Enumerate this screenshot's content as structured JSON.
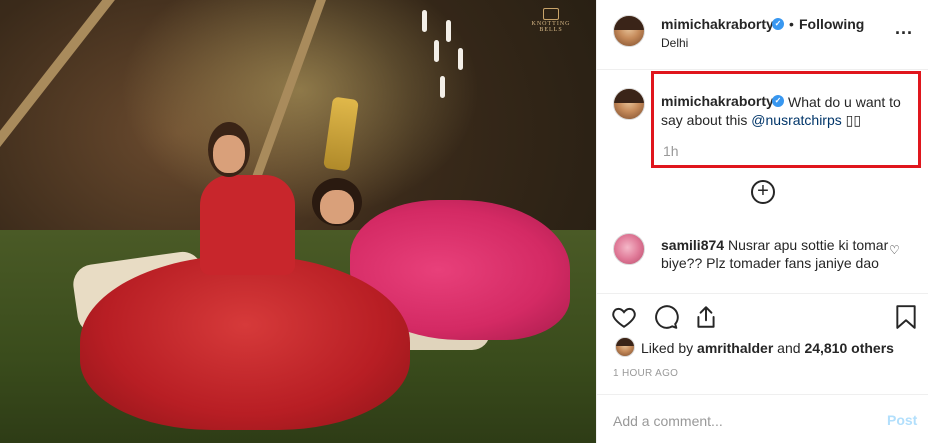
{
  "photo": {
    "alt_watermark": "KNOTTING BELLS",
    "icon": "wedding-photo"
  },
  "header": {
    "username": "mimichakraborty",
    "verified_icon": "verified-badge-icon",
    "separator": "•",
    "follow_status": "Following",
    "location": "Delhi",
    "more_icon": "more-options-icon",
    "more_label": "..."
  },
  "caption": {
    "username": "mimichakraborty",
    "text_before": "What do u want to say about this ",
    "mention": "@nusratchirps",
    "text_after": " ▯▯",
    "time": "1h",
    "highlight_color": "#e0161d"
  },
  "load_more": {
    "icon": "plus-circle-icon",
    "label": "+"
  },
  "comments": [
    {
      "username": "samili874",
      "text": "Nusrar apu sottie ki tomar biye?? Plz tomader fans janiye dao",
      "like_icon": "heart-outline-icon",
      "like_label": "♡"
    }
  ],
  "actions": {
    "like_icon": "heart-icon",
    "comment_icon": "comment-icon",
    "share_icon": "share-icon",
    "save_icon": "bookmark-icon"
  },
  "likes": {
    "prefix": "Liked by ",
    "user": "amrithalder",
    "middle": " and ",
    "count": "24,810 others"
  },
  "timestamp": "1 HOUR AGO",
  "add_comment": {
    "placeholder": "Add a comment...",
    "post_label": "Post",
    "post_color": "#b2dffc"
  },
  "colors": {
    "verified": "#3897f0",
    "mention": "#003569",
    "muted": "#999999"
  }
}
